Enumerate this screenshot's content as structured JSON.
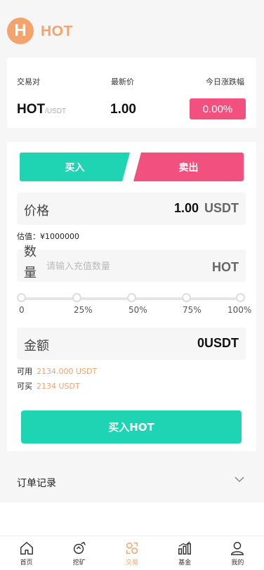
{
  "brand": {
    "logo_letter": "H",
    "name": "HOT"
  },
  "ticker": {
    "pair_label": "交易对",
    "price_label": "最新价",
    "change_label": "今日涨跌幅",
    "base": "HOT",
    "quote": "/USDT",
    "price": "1.00",
    "change": "0.00%",
    "change_color": "#f2517f"
  },
  "tabs": {
    "buy": "买入",
    "sell": "卖出"
  },
  "price_field": {
    "label": "价格",
    "value": "1.00",
    "unit": "USDT"
  },
  "estimate": "估值：¥1000000",
  "quantity_field": {
    "label": "数量",
    "placeholder": "请输入充值数量",
    "unit": "HOT"
  },
  "slider": {
    "marks": [
      "0",
      "25%",
      "50%",
      "75%",
      "100%"
    ],
    "value_percent": 0
  },
  "amount_field": {
    "label": "金额",
    "value": "0USDT"
  },
  "available": {
    "label": "可用",
    "value": "2134.000 USDT"
  },
  "buyable": {
    "label": "可买",
    "value": "2134 USDT"
  },
  "submit_label": "买入HOT",
  "orders_label": "订单记录",
  "tabbar": [
    {
      "label": "首页",
      "icon": "home-icon"
    },
    {
      "label": "挖矿",
      "icon": "mining-icon"
    },
    {
      "label": "交易",
      "icon": "trade-icon",
      "active": true
    },
    {
      "label": "基金",
      "icon": "fund-chart-icon"
    },
    {
      "label": "我的",
      "icon": "user-icon"
    }
  ],
  "colors": {
    "accent": "#1ed4b2",
    "sell": "#f2517f",
    "brand": "#f5a36c"
  }
}
